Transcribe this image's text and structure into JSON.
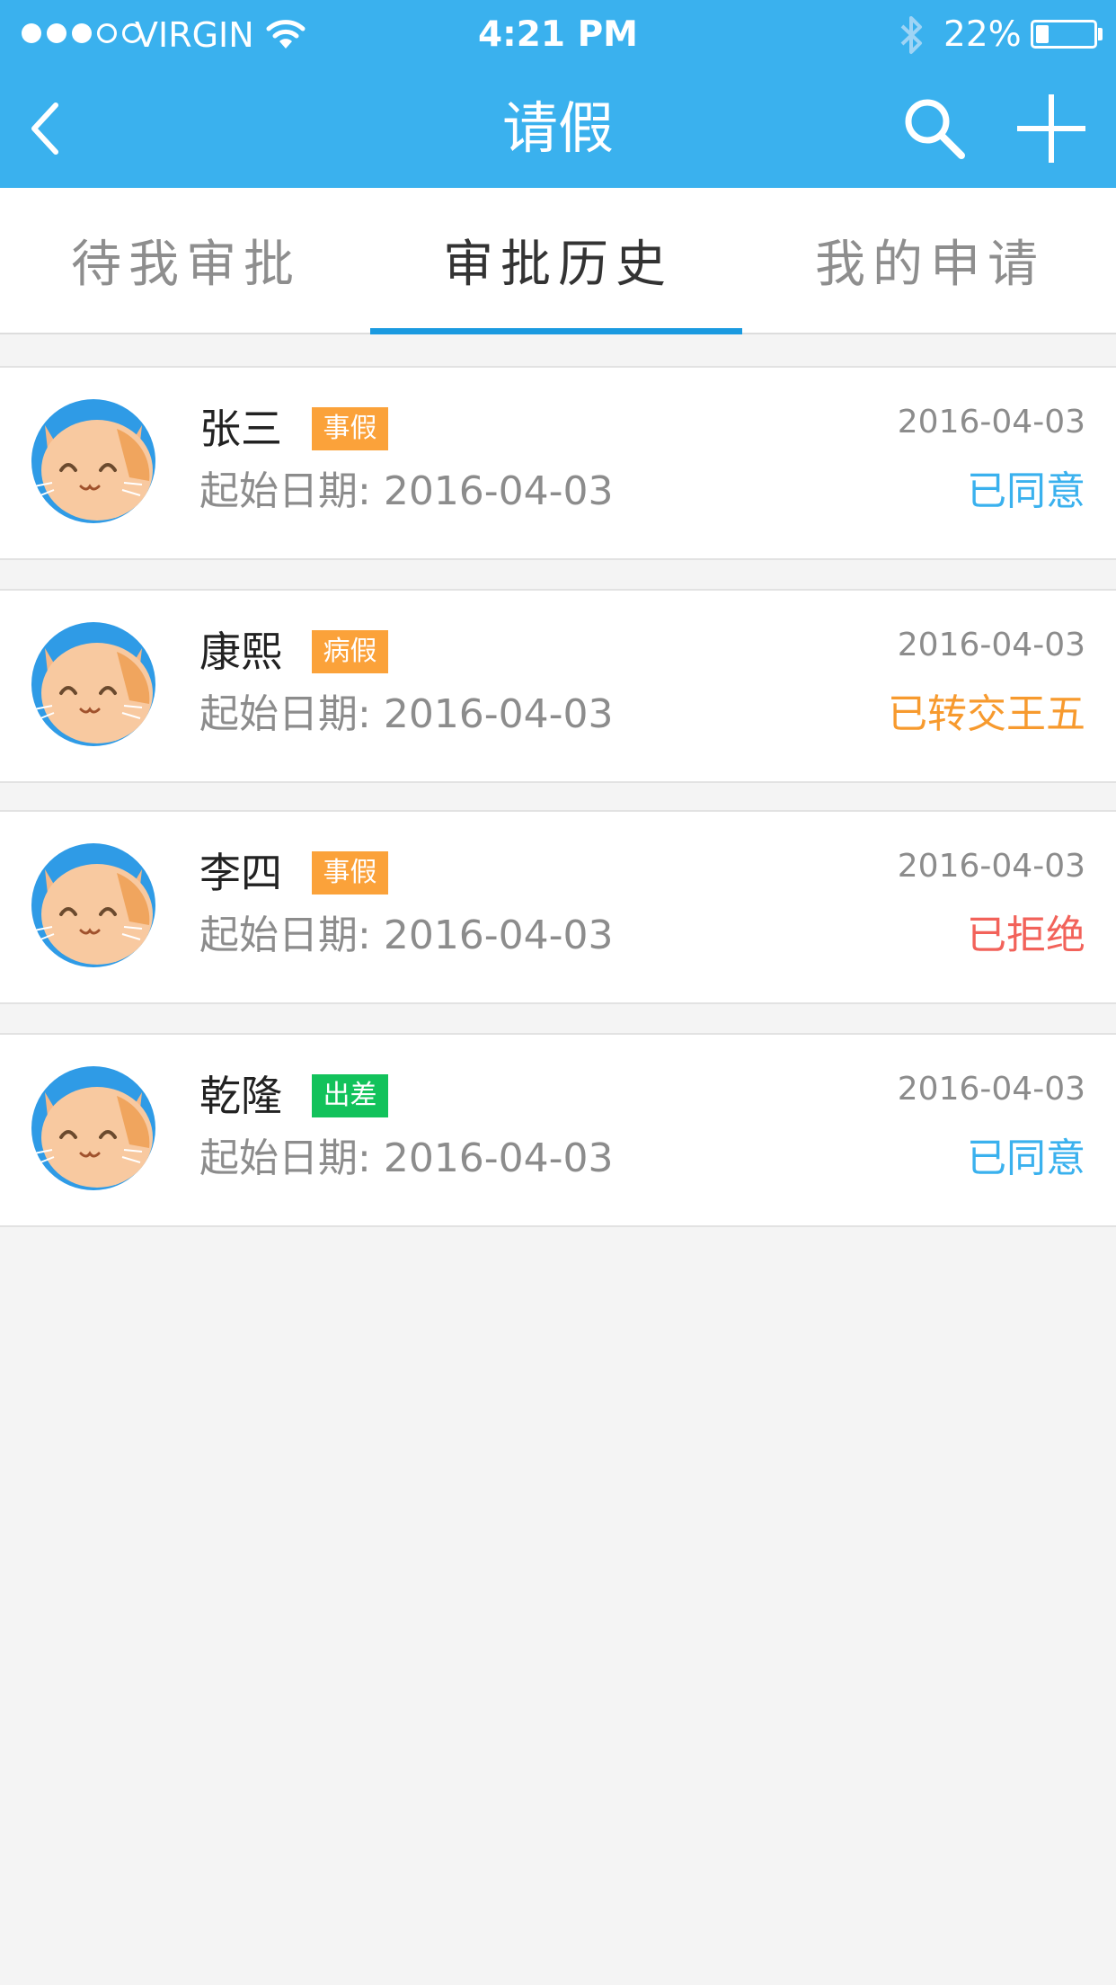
{
  "status_bar": {
    "carrier": "VIRGIN",
    "time": "4:21 PM",
    "battery_percent": "22%",
    "battery_level": 0.22,
    "signal_bars": 3
  },
  "nav": {
    "title": "请假",
    "back_icon": "chevron-left-icon",
    "search_icon": "search-icon",
    "add_icon": "plus-icon"
  },
  "tabs": [
    {
      "label": "待我审批",
      "active": false
    },
    {
      "label": "审批历史",
      "active": true
    },
    {
      "label": "我的申请",
      "active": false
    }
  ],
  "records": [
    {
      "name": "张三",
      "tag": "事假",
      "tag_color": "#fba23a",
      "start_label": "起始日期:",
      "start_date": "2016-04-03",
      "date": "2016-04-03",
      "status": "已同意",
      "status_color": "#3ab1ee"
    },
    {
      "name": "康熙",
      "tag": "病假",
      "tag_color": "#fba23a",
      "start_label": "起始日期:",
      "start_date": "2016-04-03",
      "date": "2016-04-03",
      "status": "已转交王五",
      "status_color": "#f79a2e"
    },
    {
      "name": "李四",
      "tag": "事假",
      "tag_color": "#fba23a",
      "start_label": "起始日期:",
      "start_date": "2016-04-03",
      "date": "2016-04-03",
      "status": "已拒绝",
      "status_color": "#f2625a"
    },
    {
      "name": "乾隆",
      "tag": "出差",
      "tag_color": "#12c25b",
      "start_label": "起始日期:",
      "start_date": "2016-04-03",
      "date": "2016-04-03",
      "status": "已同意",
      "status_color": "#3ab1ee"
    }
  ],
  "colors": {
    "header_bg": "#3ab1ee",
    "tab_underline": "#1a9ae0",
    "page_bg": "#f4f4f4"
  }
}
